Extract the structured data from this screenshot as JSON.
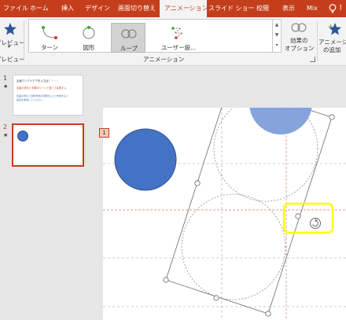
{
  "tabs": [
    "ファイル",
    "ホーム",
    "挿入",
    "デザイン",
    "画面切り替え",
    "アニメーション",
    "スライド ショー",
    "校閲",
    "表示",
    "Mix"
  ],
  "ribbon": {
    "preview_label": "プレビュー",
    "preview_group": "プレビュー",
    "gallery": [
      "ターン",
      "図形",
      "ループ",
      "ユーザー設..."
    ],
    "animation_group": "アニメーション",
    "effect_options": [
      "効果の",
      "オプション"
    ],
    "add_animation": [
      "アニメーション",
      "の追加"
    ]
  },
  "thumbnails": {
    "slide1_number": "1",
    "slide1_star": "★",
    "slide1_lines": [
      "企画ワンアイデアを入力は！・・・",
      "企画の流れと手順のリーンと進っては進すム",
      "企画の流れと資料作成の手順をもとに作成すると",
      "設定を使用してください"
    ],
    "slide2_number": "2",
    "slide2_star": "★"
  },
  "slide": {
    "tag": "1"
  },
  "colors": {
    "accent": "#c43e1c",
    "circle_blue": "#4472c4",
    "circle_light": "#7f9fd9",
    "highlight": "#ffff00"
  }
}
